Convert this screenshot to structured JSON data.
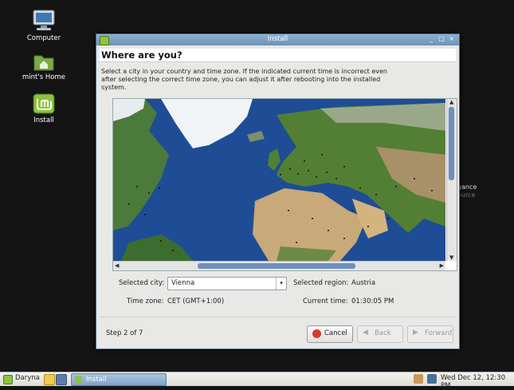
{
  "desktop": {
    "icons": [
      {
        "label": "Computer"
      },
      {
        "label": "mint's Home"
      },
      {
        "label": "Install"
      }
    ],
    "bg_text_1": "gance",
    "bg_text_2": "ource"
  },
  "window": {
    "title": "Install",
    "heading": "Where are you?",
    "description": "Select a city in your country and time zone. If the indicated current time is incorrect even after selecting the correct time zone, you can adjust it after rebooting into the installed system.",
    "fields": {
      "city_label": "Selected city:",
      "city_value": "Vienna",
      "region_label": "Selected region:",
      "region_value": "Austria",
      "tz_label": "Time zone:",
      "tz_value": "CET (GMT+1:00)",
      "time_label": "Current time:",
      "time_value": "01:30:05 PM"
    },
    "step": "Step 2 of 7",
    "buttons": {
      "cancel": "Cancel",
      "back": "Back",
      "forward": "Forward"
    }
  },
  "taskbar": {
    "menu_label": "Daryna",
    "task_label": "Install",
    "clock": "Wed Dec 12, 12:30 PM"
  }
}
